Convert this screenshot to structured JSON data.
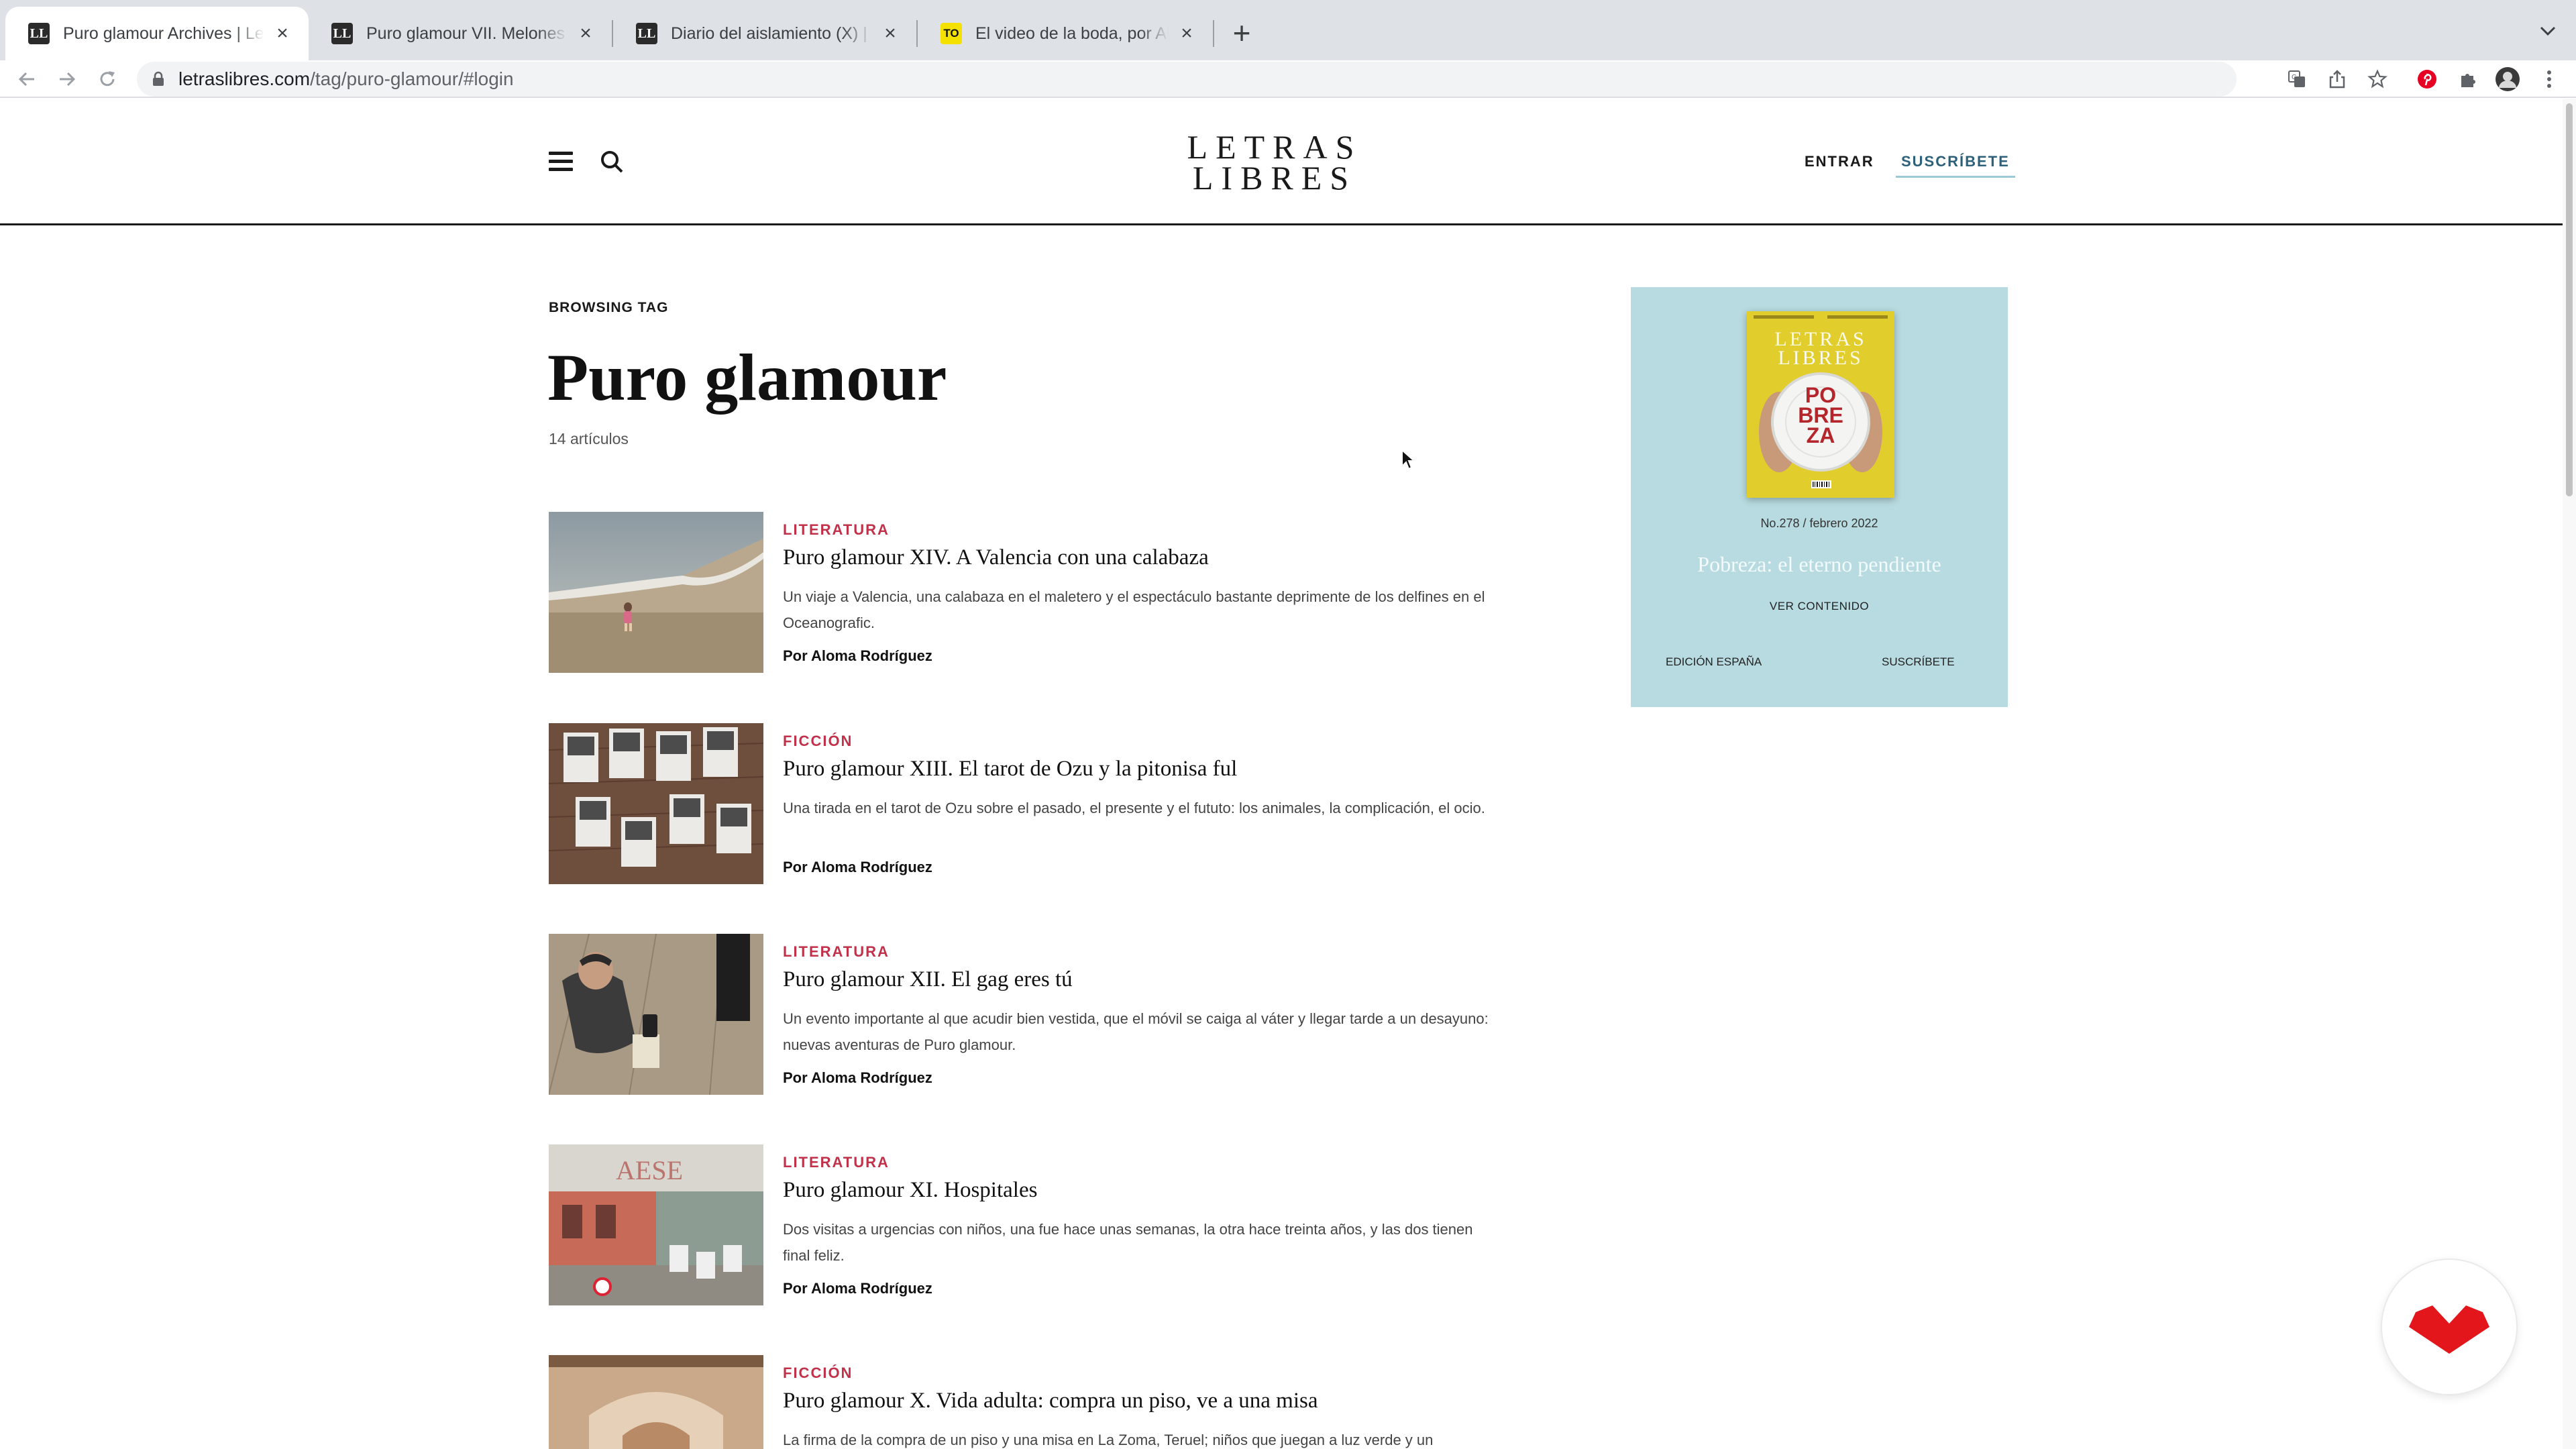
{
  "browser": {
    "tabs": [
      {
        "title": "Puro glamour Archives | Letras Libres",
        "favicon": "LL",
        "active": true
      },
      {
        "title": "Puro glamour VII. Melones en el",
        "favicon": "LL",
        "active": false
      },
      {
        "title": "Diario del aislamiento (X) | Letras",
        "favicon": "LL",
        "active": false
      },
      {
        "title": "El video de la boda, por Aloma",
        "favicon": "TO",
        "active": false
      }
    ],
    "close_glyph": "×",
    "new_tab_glyph": "+",
    "url_main": "letraslibres.com",
    "url_path": "/tag/puro-glamour/#login"
  },
  "header": {
    "logo_line1": "LETRAS",
    "logo_line2": "LIBRES",
    "login_label": "ENTRAR",
    "subscribe_label": "SUSCRÍBETE"
  },
  "page": {
    "browsing_label": "BROWSING TAG",
    "title": "Puro glamour",
    "count": "14 artículos"
  },
  "articles": [
    {
      "category": "LITERATURA",
      "title": "Puro glamour XIV. A Valencia con una calabaza",
      "excerpt": "Un viaje a Valencia, una calabaza en el maletero y el espectáculo bastante deprimente de los delfines en el Oceanografic.",
      "author": "Por Aloma Rodríguez"
    },
    {
      "category": "FICCIÓN",
      "title": "Puro glamour XIII. El tarot de Ozu y la pitonisa ful",
      "excerpt": "Una tirada en el tarot de Ozu sobre el pasado, el presente y el fututo: los animales, la complicación, el ocio.",
      "author": "Por Aloma Rodríguez"
    },
    {
      "category": "LITERATURA",
      "title": "Puro glamour XII. El gag eres tú",
      "excerpt": "Un evento importante al que acudir bien vestida, que el móvil se caiga al váter y llegar tarde a un desayuno: nuevas aventuras de Puro glamour.",
      "author": "Por Aloma Rodríguez"
    },
    {
      "category": "LITERATURA",
      "title": "Puro glamour XI. Hospitales",
      "excerpt": "Dos visitas a urgencias con niños, una fue hace unas semanas, la otra hace treinta años, y las dos tienen final feliz.",
      "author": "Por Aloma Rodríguez"
    },
    {
      "category": "FICCIÓN",
      "title": "Puro glamour X. Vida adulta: compra un piso, ve a una misa",
      "excerpt": "La firma de la compra de un piso y una misa en La Zoma, Teruel; niños que juegan a luz verde y un",
      "author": ""
    }
  ],
  "magazine": {
    "cover_logo_line1": "LETRAS",
    "cover_logo_line2": "LIBRES",
    "cover_word_1": "PO",
    "cover_word_2": "BRE",
    "cover_word_3": "ZA",
    "issue": "No.278 / febrero 2022",
    "headline": "Pobreza: el eterno pendiente",
    "contents_label": "VER CONTENIDO",
    "edition_label": "EDICIÓN ESPAÑA",
    "subscribe_label": "SUSCRÍBETE",
    "background_color": "#b7dbe0"
  },
  "colors": {
    "category": "#c1314a",
    "subscribe_accent": "#2d6079",
    "float_logo": "#e3161b"
  }
}
